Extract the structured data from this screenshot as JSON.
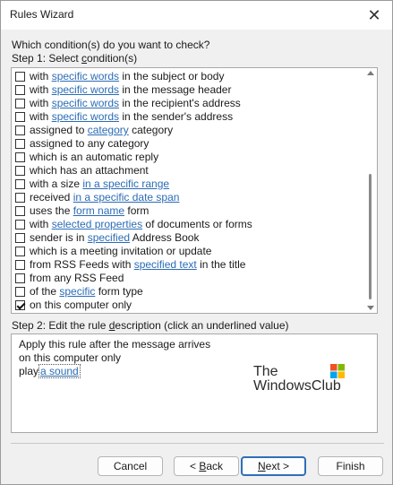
{
  "window": {
    "title": "Rules Wizard",
    "close_glyph": "✕"
  },
  "question": "Which condition(s) do you want to check?",
  "step1": {
    "prefix": "Step 1: Select ",
    "underlined": "c",
    "rest": "ondition(s)"
  },
  "conditions": [
    {
      "checked": false,
      "parts": [
        {
          "t": "with "
        },
        {
          "t": "specific words",
          "link": true
        },
        {
          "t": " in the subject or body"
        }
      ]
    },
    {
      "checked": false,
      "parts": [
        {
          "t": "with "
        },
        {
          "t": "specific words",
          "link": true
        },
        {
          "t": " in the message header"
        }
      ]
    },
    {
      "checked": false,
      "parts": [
        {
          "t": "with "
        },
        {
          "t": "specific words",
          "link": true
        },
        {
          "t": " in the recipient's address"
        }
      ]
    },
    {
      "checked": false,
      "parts": [
        {
          "t": "with "
        },
        {
          "t": "specific words",
          "link": true
        },
        {
          "t": " in the sender's address"
        }
      ]
    },
    {
      "checked": false,
      "parts": [
        {
          "t": "assigned to "
        },
        {
          "t": "category",
          "link": true
        },
        {
          "t": " category"
        }
      ]
    },
    {
      "checked": false,
      "parts": [
        {
          "t": "assigned to any category"
        }
      ]
    },
    {
      "checked": false,
      "parts": [
        {
          "t": "which is an automatic reply"
        }
      ]
    },
    {
      "checked": false,
      "parts": [
        {
          "t": "which has an attachment"
        }
      ]
    },
    {
      "checked": false,
      "parts": [
        {
          "t": "with a size "
        },
        {
          "t": "in a specific range",
          "link": true
        }
      ]
    },
    {
      "checked": false,
      "parts": [
        {
          "t": "received "
        },
        {
          "t": "in a specific date span",
          "link": true
        }
      ]
    },
    {
      "checked": false,
      "parts": [
        {
          "t": "uses the "
        },
        {
          "t": "form name",
          "link": true
        },
        {
          "t": " form"
        }
      ]
    },
    {
      "checked": false,
      "parts": [
        {
          "t": "with "
        },
        {
          "t": "selected properties",
          "link": true
        },
        {
          "t": " of documents or forms"
        }
      ]
    },
    {
      "checked": false,
      "parts": [
        {
          "t": "sender is in "
        },
        {
          "t": "specified",
          "link": true
        },
        {
          "t": " Address Book"
        }
      ]
    },
    {
      "checked": false,
      "parts": [
        {
          "t": "which is a meeting invitation or update"
        }
      ]
    },
    {
      "checked": false,
      "parts": [
        {
          "t": "from RSS Feeds with "
        },
        {
          "t": "specified text",
          "link": true
        },
        {
          "t": " in the title"
        }
      ]
    },
    {
      "checked": false,
      "parts": [
        {
          "t": "from any RSS Feed"
        }
      ]
    },
    {
      "checked": false,
      "parts": [
        {
          "t": "of the "
        },
        {
          "t": "specific",
          "link": true
        },
        {
          "t": " form type"
        }
      ]
    },
    {
      "checked": true,
      "parts": [
        {
          "t": "on this computer only"
        }
      ]
    }
  ],
  "step2": {
    "prefix": "Step 2: Edit the rule ",
    "underlined": "d",
    "rest": "escription (click an underlined value)"
  },
  "description": {
    "line1": "Apply this rule after the message arrives",
    "line2": "on this computer only",
    "line3_prefix": "play",
    "line3_link": "a sound"
  },
  "watermark": {
    "line1": "The",
    "line2": "WindowsClub"
  },
  "buttons": {
    "cancel": "Cancel",
    "back_prefix": "< ",
    "back_ul": "B",
    "back_rest": "ack",
    "next_ul": "N",
    "next_rest": "ext >",
    "finish": "Finish"
  },
  "colors": {
    "link": "#2b6cb5",
    "primary_border": "#2f6fb8"
  }
}
